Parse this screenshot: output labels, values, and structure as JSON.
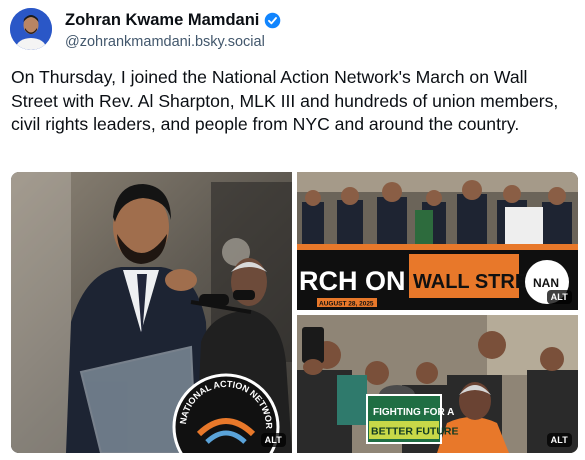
{
  "author": {
    "display_name": "Zohran Kwame Mamdani",
    "handle": "@zohrankmamdani.bsky.social",
    "verified": true,
    "avatar_bg": "#2a57c7"
  },
  "post": {
    "text": "On Thursday, I joined the National Action Network's March on Wall Street with Rev. Al Sharpton, MLK III and hundreds of union members, civil rights leaders, and people from NYC and around the country."
  },
  "images": [
    {
      "alt_badge": "ALT",
      "podium_sign": "NATIONAL ACTION NETWORK"
    },
    {
      "alt_badge": "ALT",
      "banner_left": "RCH ON",
      "banner_right": "WALL STREET",
      "banner_logo": "NAN",
      "banner_date": "AUGUST 28, 2025"
    },
    {
      "alt_badge": "ALT",
      "sign_line1": "FIGHTING FOR A",
      "sign_line2": "BETTER FUTURE"
    }
  ],
  "colors": {
    "verified_badge": "#1185fe",
    "handle_text": "#42576c",
    "banner_orange": "#e8782a"
  }
}
